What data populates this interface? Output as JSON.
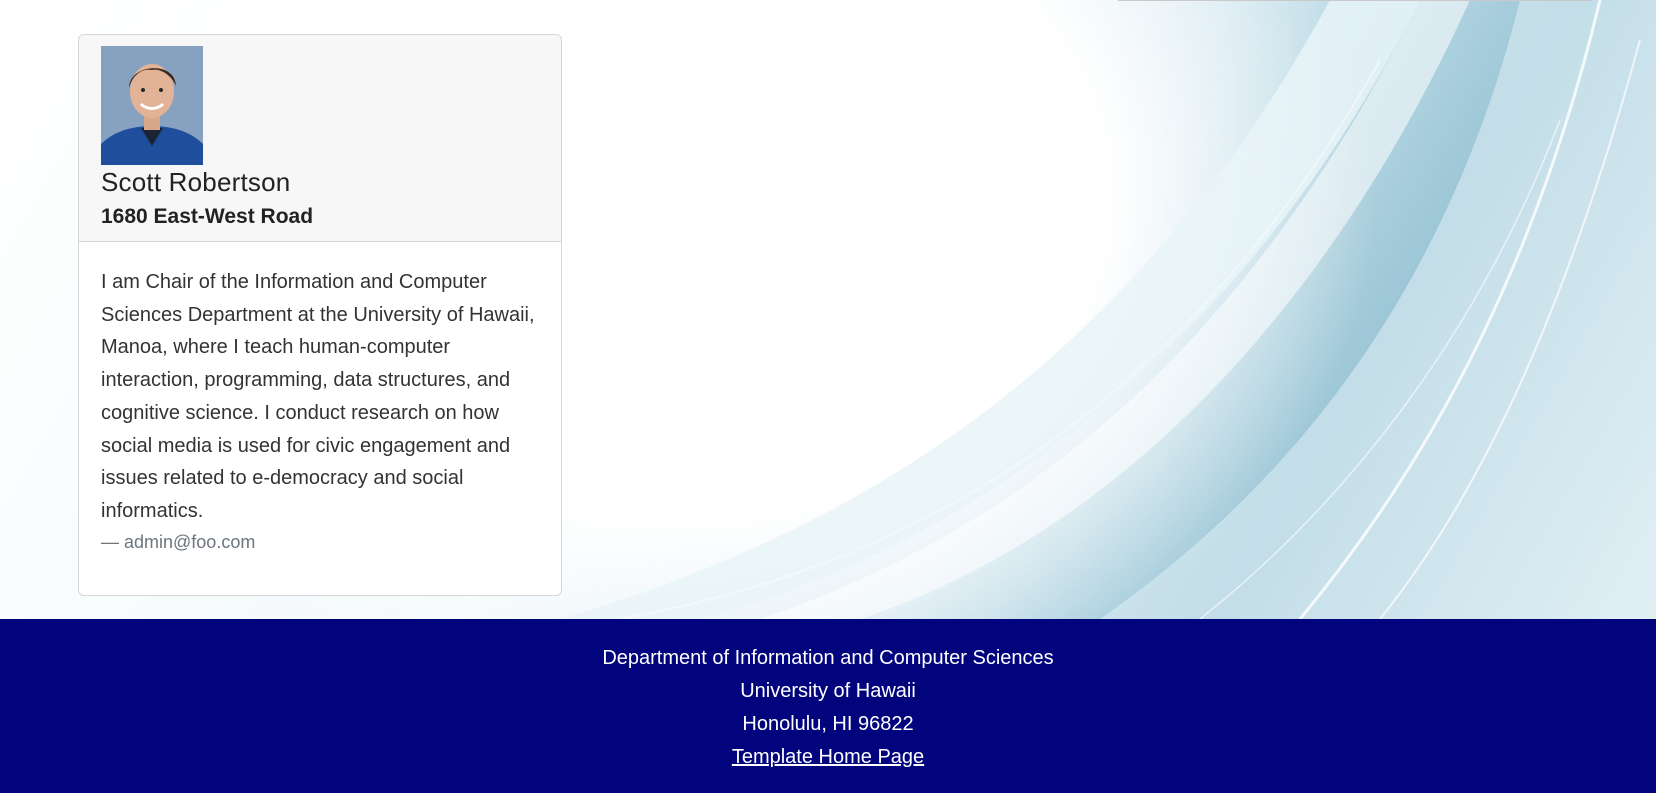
{
  "profile": {
    "name": "Scott Robertson",
    "address": "1680 East-West Road",
    "bio": "I am Chair of the Information and Computer Sciences Department at the University of Hawaii, Manoa, where I teach human-computer interaction, programming, data structures, and cognitive science. I conduct research on how social media is used for civic engagement and issues related to e-democracy and social informatics.",
    "author": "— admin@foo.com",
    "avatar_icon": "person-photo"
  },
  "footer": {
    "line1": "Department of Information and Computer Sciences",
    "line2": "University of Hawaii",
    "line3": "Honolulu, HI 96822",
    "link": "Template Home Page"
  },
  "colors": {
    "footer_bg": "#02047e",
    "hero_accent": "#9dc7d7"
  }
}
